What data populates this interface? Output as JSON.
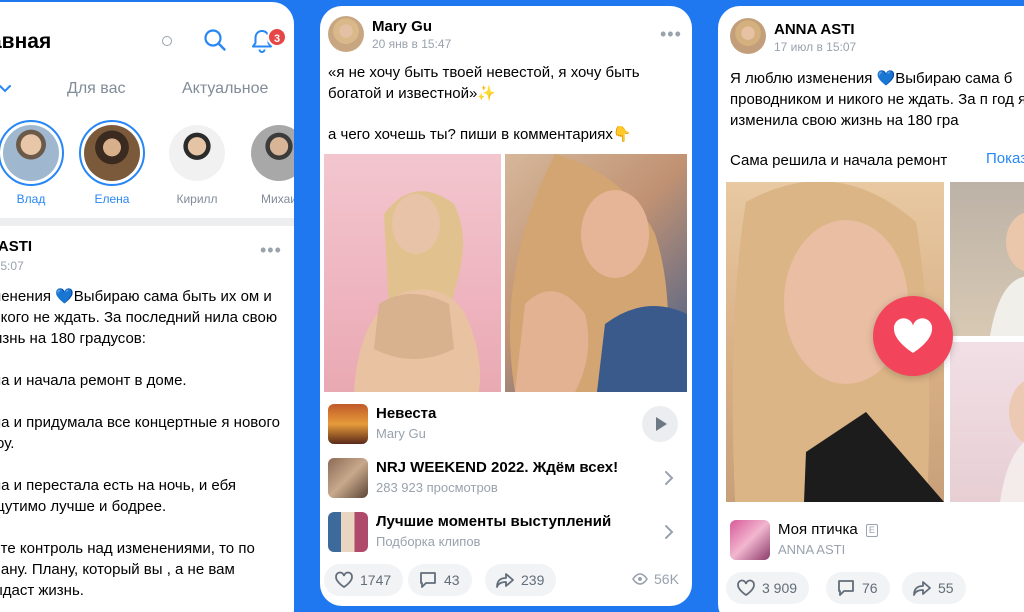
{
  "colors": {
    "accent": "#2787f5",
    "background": "#1f78f0",
    "badge": "#e64646",
    "like": "#f2455b"
  },
  "panel1": {
    "title": "авная",
    "notification_count": "3",
    "tabs": [
      "Для вас",
      "Актуальное"
    ],
    "stories": [
      "Влад",
      "Елена",
      "Кирилл",
      "Михаи"
    ],
    "post": {
      "author": "A ASTI",
      "date": "в 15:07",
      "paragraphs": [
        "зменения 💙Выбираю сама быть их ом и никого не ждать. За последний нила свою жизнь на 180 градусов:",
        "ала и начала ремонт в доме.",
        "ала и придумала все концертные я нового шоу.",
        "ала и перестала есть на ночь, и ебя ощутимо лучше и бодрее.",
        "рёте контроль над изменениями, то по плану. Плану, который вы , а не вам выдаст жизнь."
      ]
    }
  },
  "panel2": {
    "author": "Mary Gu",
    "date": "20 янв в 15:47",
    "text1": "«я не хочу быть твоей невестой, я хочу быть богатой и известной»✨",
    "text2": "а чего хочешь ты? пиши в комментариях👇",
    "attachments": [
      {
        "title": "Невеста",
        "subtitle": "Mary Gu",
        "icon": "play-icon"
      },
      {
        "title": "NRJ WEEKEND 2022. Ждём всех!",
        "subtitle": "283 923 просмотров",
        "icon": "chevron-right-icon"
      },
      {
        "title": "Лучшие моменты выступлений",
        "subtitle": "Подборка клипов",
        "icon": "chevron-right-icon"
      }
    ],
    "likes": "1747",
    "comments": "43",
    "shares": "239",
    "views": "56K"
  },
  "panel3": {
    "author": "ANNA ASTI",
    "date": "17 июл в 15:07",
    "text": "Я люблю изменения 💙Выбираю сама б проводником и никого не ждать. За п год я изменила свою жизнь на 180 гра",
    "line2": "Сама решила и начала ремонт",
    "show_more": "Показ",
    "attachment": {
      "title": "Моя птичка",
      "subtitle": "ANNA ASTI",
      "explicit": "E"
    },
    "likes": "3 909",
    "comments": "76",
    "shares": "55"
  }
}
